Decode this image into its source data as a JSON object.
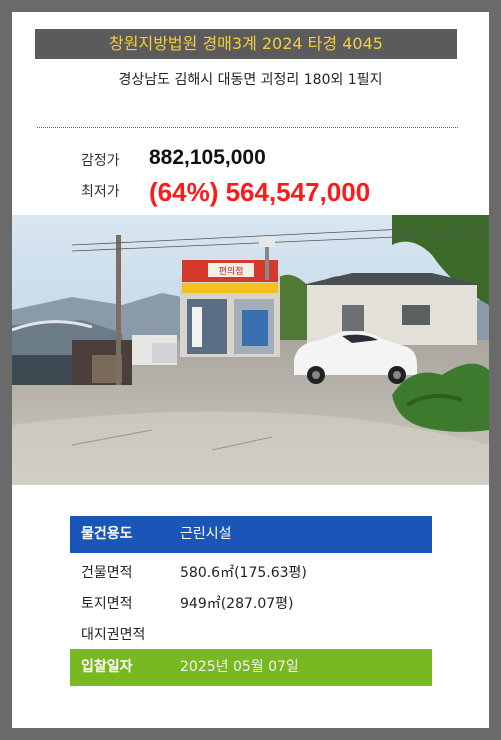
{
  "case": {
    "title": "창원지방법원 경매3계 2024 타경 4045",
    "address": "경상남도 김해시 대동면 괴정리 180외 1필지"
  },
  "prices": {
    "appraisal_label": "감정가",
    "appraisal_value": "882,105,000",
    "minimum_label": "최저가",
    "minimum_value": "(64%) 564,547,000"
  },
  "details": {
    "usage_label": "물건용도",
    "usage_value": "근린시설",
    "building_area_label": "건물면적",
    "building_area_value": "580.6㎡(175.63평)",
    "land_area_label": "토지면적",
    "land_area_value": "949㎡(287.07평)",
    "land_right_label": "대지권면적",
    "land_right_value": "",
    "bid_date_label": "입찰일자",
    "bid_date_value": "2025년 05월 07일"
  },
  "photo": {
    "sign_text": "편의점"
  },
  "colors": {
    "frame": "#6a6a6a",
    "banner_bg": "#5b5b5b",
    "banner_text": "#f2cf3a",
    "minimum_price": "#ff1a1a",
    "usage_row": "#1a56b8",
    "bid_row": "#78b820"
  }
}
